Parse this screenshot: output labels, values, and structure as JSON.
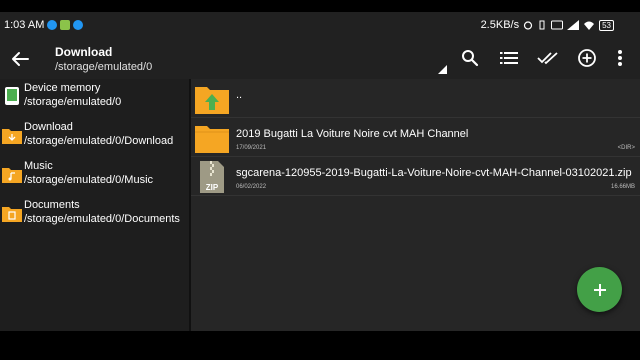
{
  "status_bar": {
    "time": "1:03 AM",
    "speed": "2.5KB/s",
    "battery": "53",
    "left_icons": [
      "messenger-icon",
      "notification-icon",
      "messenger-icon"
    ]
  },
  "toolbar": {
    "title": "Download",
    "subtitle": "/storage/emulated/0",
    "icons": [
      "search-icon",
      "list-view-icon",
      "select-all-icon",
      "add-icon",
      "more-icon"
    ]
  },
  "sidebar": {
    "items": [
      {
        "label": "Device memory",
        "path": "/storage/emulated/0",
        "icon": "device-memory-icon"
      },
      {
        "label": "Download",
        "path": "/storage/emulated/0/Download",
        "icon": "download-folder-icon"
      },
      {
        "label": "Music",
        "path": "/storage/emulated/0/Music",
        "icon": "music-folder-icon"
      },
      {
        "label": "Documents",
        "path": "/storage/emulated/0/Documents",
        "icon": "documents-folder-icon"
      }
    ]
  },
  "files": [
    {
      "name": "..",
      "date": "",
      "meta": "",
      "icon": "parent-folder-icon"
    },
    {
      "name": "2019 Bugatti La Voiture Noire cvt MAH Channel",
      "date": "17/09/2021",
      "meta": "<DIR>",
      "icon": "folder-icon"
    },
    {
      "name": "sgcarena-120955-2019-Bugatti-La-Voiture-Noire-cvt-MAH-Channel-03102021.zip",
      "date": "06/02/2022",
      "meta": "16.66MB",
      "icon": "zip-file-icon",
      "badge": "ZIP"
    }
  ],
  "colors": {
    "accent": "#43a047",
    "folder": "#f5a623",
    "toolbar": "#212121",
    "background": "#262626"
  }
}
